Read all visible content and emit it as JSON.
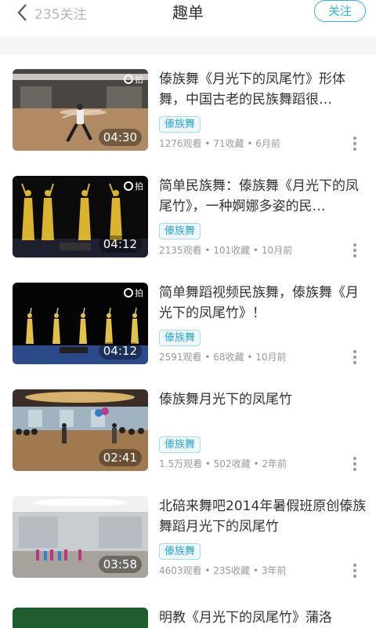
{
  "header": {
    "back_label": "235关注",
    "title": "趣单",
    "follow_label": "关注"
  },
  "thumb_logo": "拍",
  "items": [
    {
      "title": "傣族舞《月光下的凤尾竹》形体舞，中国古老的民族舞蹈很…",
      "tag": "傣族舞",
      "stats": "1276观看 • 71收藏 • 6月前",
      "duration": "04:30",
      "logo": true
    },
    {
      "title": "简单民族舞：傣族舞《月光下的凤尾竹》，一种婀娜多姿的民…",
      "tag": "傣族舞",
      "stats": "2135观看 • 101收藏 • 10月前",
      "duration": "04:12",
      "logo": true
    },
    {
      "title": "简单舞蹈视频民族舞，傣族舞《月光下的凤尾竹》！",
      "tag": "傣族舞",
      "stats": "2591观看 • 68收藏 • 10月前",
      "duration": "04:12",
      "logo": true
    },
    {
      "title": "傣族舞月光下的凤尾竹",
      "tag": "傣族舞",
      "stats": "1.5万观看 • 502收藏 • 2年前",
      "duration": "02:41",
      "logo": false
    },
    {
      "title": "北碚来舞吧2014年暑假班原创傣族舞蹈月光下的凤尾竹",
      "tag": "傣族舞",
      "stats": "4603观看 • 235收藏 • 3年前",
      "duration": "03:58",
      "logo": false
    }
  ],
  "partial_title": "明教《月光下的凤尾竹》蒲洛"
}
